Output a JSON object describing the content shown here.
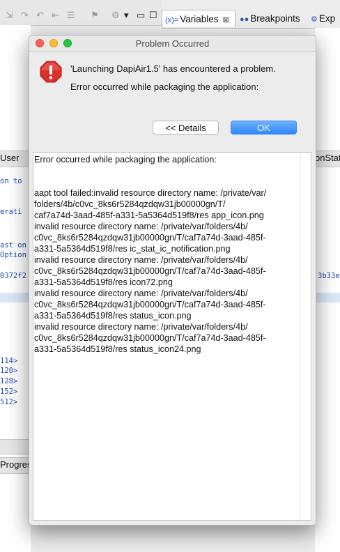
{
  "background": {
    "tabs": [
      {
        "icon": "(x)=",
        "label": "Variables",
        "close": "⊠"
      },
      {
        "icon": "●●",
        "label": "Breakpoints"
      },
      {
        "icon": "⚙",
        "label": "Exp"
      }
    ],
    "left_tab": "User",
    "right_tab": "onStat",
    "progress_tab": "Progres",
    "editor_lines": [
      "on to",
      "erati",
      "ast on",
      "Option",
      "0372f2",
      "114>",
      "120>",
      "128>",
      "152>",
      "512>"
    ],
    "right_lines": [
      "3b33e"
    ]
  },
  "dialog": {
    "title": "Problem Occurred",
    "message_title": "'Launching DapiAir1.5' has encountered a problem.",
    "message_body": "Error occurred while packaging the application:",
    "details_button": "<< Details",
    "ok_button": "OK",
    "details_lines": [
      "Error occurred while packaging the application:",
      "",
      "",
      "aapt tool failed:invalid resource directory name: /private/var/",
      "folders/4b/c0vc_8ks6r5284qzdqw31jb00000gn/T/",
      "caf7a74d-3aad-485f-a331-5a5364d519f8/res app_icon.png",
      "invalid resource directory name: /private/var/folders/4b/",
      "c0vc_8ks6r5284qzdqw31jb00000gn/T/caf7a74d-3aad-485f-",
      "a331-5a5364d519f8/res ic_stat_ic_notification.png",
      "invalid resource directory name: /private/var/folders/4b/",
      "c0vc_8ks6r5284qzdqw31jb00000gn/T/caf7a74d-3aad-485f-",
      "a331-5a5364d519f8/res icon72.png",
      "invalid resource directory name: /private/var/folders/4b/",
      "c0vc_8ks6r5284qzdqw31jb00000gn/T/caf7a74d-3aad-485f-",
      "a331-5a5364d519f8/res status_icon.png",
      "invalid resource directory name: /private/var/folders/4b/",
      "c0vc_8ks6r5284qzdqw31jb00000gn/T/caf7a74d-3aad-485f-",
      "a331-5a5364d519f8/res status_icon24.png"
    ]
  },
  "colors": {
    "ok_button": "#2e86f5",
    "error_icon": "#d9302c",
    "close_light": "#fc5f57",
    "minimize_light": "#fdbc2e",
    "zoom_light": "#28c840"
  }
}
